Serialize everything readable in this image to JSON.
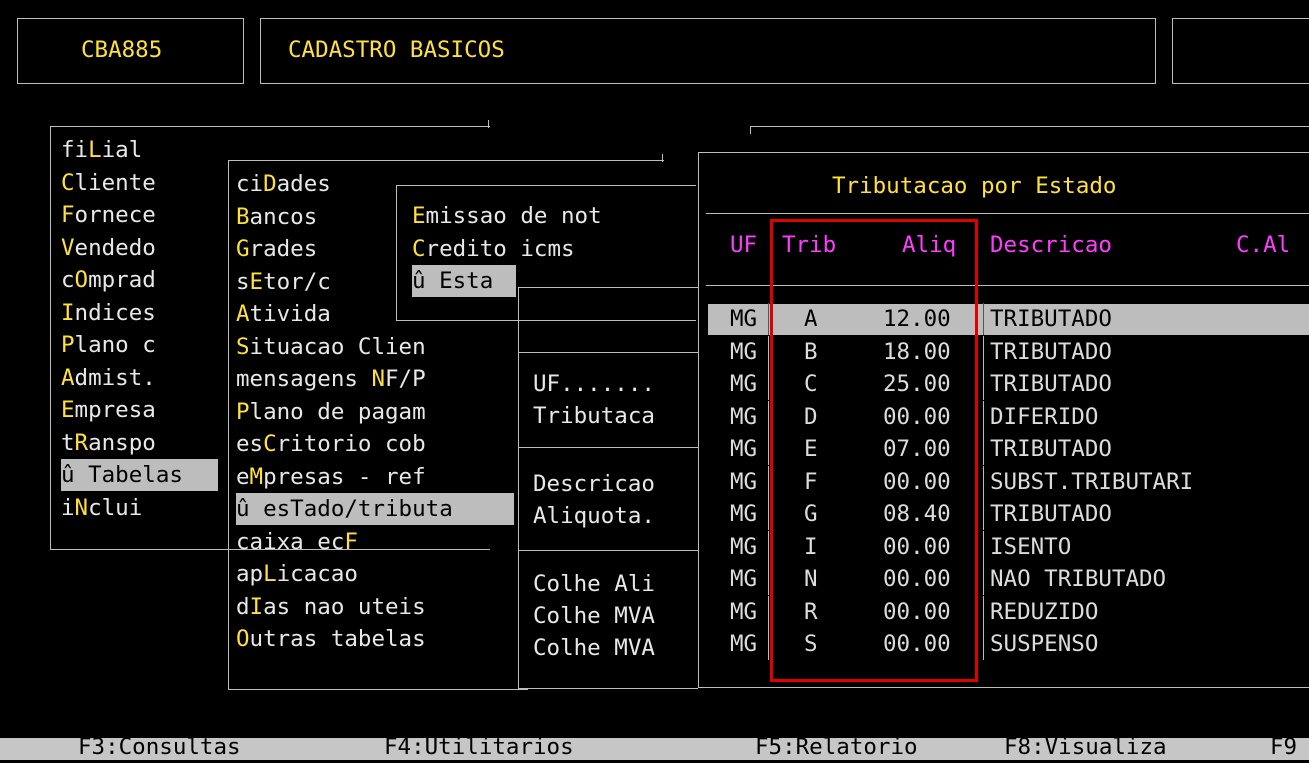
{
  "header": {
    "program_code": "CBA885",
    "title": "CADASTRO BASICOS"
  },
  "menu1": [
    {
      "pre": "fi",
      "hot": "L",
      "post": "ial",
      "selected": false
    },
    {
      "pre": "",
      "hot": "C",
      "post": "liente",
      "selected": false
    },
    {
      "pre": "",
      "hot": "F",
      "post": "ornece",
      "selected": false
    },
    {
      "pre": "",
      "hot": "V",
      "post": "endedo",
      "selected": false
    },
    {
      "pre": "c",
      "hot": "O",
      "post": "mprad",
      "selected": false
    },
    {
      "pre": "",
      "hot": "I",
      "post": "ndices",
      "selected": false
    },
    {
      "pre": "",
      "hot": "P",
      "post": "lano c",
      "selected": false
    },
    {
      "pre": "",
      "hot": "A",
      "post": "dmist.",
      "selected": false
    },
    {
      "pre": "",
      "hot": "E",
      "post": "mpresa",
      "selected": false
    },
    {
      "pre": "t",
      "hot": "R",
      "post": "anspo",
      "selected": false
    },
    {
      "pre": "û Tabelas",
      "hot": "",
      "post": "",
      "selected": true
    },
    {
      "pre": "i",
      "hot": "N",
      "post": "clui",
      "selected": false
    }
  ],
  "menu2": [
    {
      "pre": "ci",
      "hot": "D",
      "post": "ades",
      "selected": false
    },
    {
      "pre": "",
      "hot": "B",
      "post": "ancos",
      "selected": false
    },
    {
      "pre": "",
      "hot": "G",
      "post": "rades",
      "selected": false
    },
    {
      "pre": "s",
      "hot": "E",
      "post": "tor/c",
      "selected": false
    },
    {
      "pre": "",
      "hot": "A",
      "post": "tivida",
      "selected": false
    },
    {
      "pre": "",
      "hot": "S",
      "post": "ituacao Clien",
      "selected": false
    },
    {
      "pre": "mensagens ",
      "hot": "N",
      "post": "F/P",
      "selected": false
    },
    {
      "pre": "",
      "hot": "P",
      "post": "lano de pagam",
      "selected": false
    },
    {
      "pre": "es",
      "hot": "C",
      "post": "ritorio cob",
      "selected": false
    },
    {
      "pre": "e",
      "hot": "M",
      "post": "presas - ref",
      "selected": false
    },
    {
      "pre": "û esTado/tributa",
      "hot": "",
      "post": "",
      "selected": true
    },
    {
      "pre": "caixa ec",
      "hot": "F",
      "post": "",
      "selected": false
    },
    {
      "pre": "ap",
      "hot": "L",
      "post": "icacao",
      "selected": false
    },
    {
      "pre": "d",
      "hot": "I",
      "post": "as nao uteis",
      "selected": false
    },
    {
      "pre": "",
      "hot": "O",
      "post": "utras tabelas",
      "selected": false
    }
  ],
  "menu3": [
    {
      "pre": "",
      "hot": "E",
      "post": "missao de not",
      "selected": false
    },
    {
      "pre": "",
      "hot": "C",
      "post": "redito icms",
      "selected": false
    },
    {
      "pre": "û Esta",
      "hot": "",
      "post": "",
      "selected": true
    }
  ],
  "form": {
    "uf_label": "UF.......",
    "trib_label": "Tributaca",
    "desc_label": "Descricao",
    "aliq_label": "Aliquota.",
    "colhe_ali": "Colhe Ali",
    "colhe_mva1": "Colhe MVA",
    "colhe_mva2": "Colhe MVA"
  },
  "table": {
    "title": "Tributacao por Estado",
    "headers": {
      "uf": "UF",
      "trib": "Trib",
      "aliq": "Aliq",
      "desc": "Descricao",
      "cal": "C.Al"
    },
    "rows": [
      {
        "uf": "MG",
        "trib": "A",
        "aliq": "12.00",
        "desc": "TRIBUTADO"
      },
      {
        "uf": "MG",
        "trib": "B",
        "aliq": "18.00",
        "desc": "TRIBUTADO"
      },
      {
        "uf": "MG",
        "trib": "C",
        "aliq": "25.00",
        "desc": "TRIBUTADO"
      },
      {
        "uf": "MG",
        "trib": "D",
        "aliq": "00.00",
        "desc": "DIFERIDO"
      },
      {
        "uf": "MG",
        "trib": "E",
        "aliq": "07.00",
        "desc": "TRIBUTADO"
      },
      {
        "uf": "MG",
        "trib": "F",
        "aliq": "00.00",
        "desc": "SUBST.TRIBUTARI"
      },
      {
        "uf": "MG",
        "trib": "G",
        "aliq": "08.40",
        "desc": "TRIBUTADO"
      },
      {
        "uf": "MG",
        "trib": "I",
        "aliq": "00.00",
        "desc": "ISENTO"
      },
      {
        "uf": "MG",
        "trib": "N",
        "aliq": "00.00",
        "desc": "NAO TRIBUTADO"
      },
      {
        "uf": "MG",
        "trib": "R",
        "aliq": "00.00",
        "desc": "REDUZIDO"
      },
      {
        "uf": "MG",
        "trib": "S",
        "aliq": "00.00",
        "desc": "SUSPENSO"
      }
    ],
    "selected_row": 0
  },
  "footer": [
    "F3:Consultas",
    "F4:Utilitarios",
    "F5:Relatorio",
    "F8:Visualiza",
    "F9"
  ],
  "colors": {
    "hotkey": "#ffe13a",
    "header_text": "#ff3cff",
    "highlight": "#e00000",
    "selection": "#bdbdbd"
  }
}
